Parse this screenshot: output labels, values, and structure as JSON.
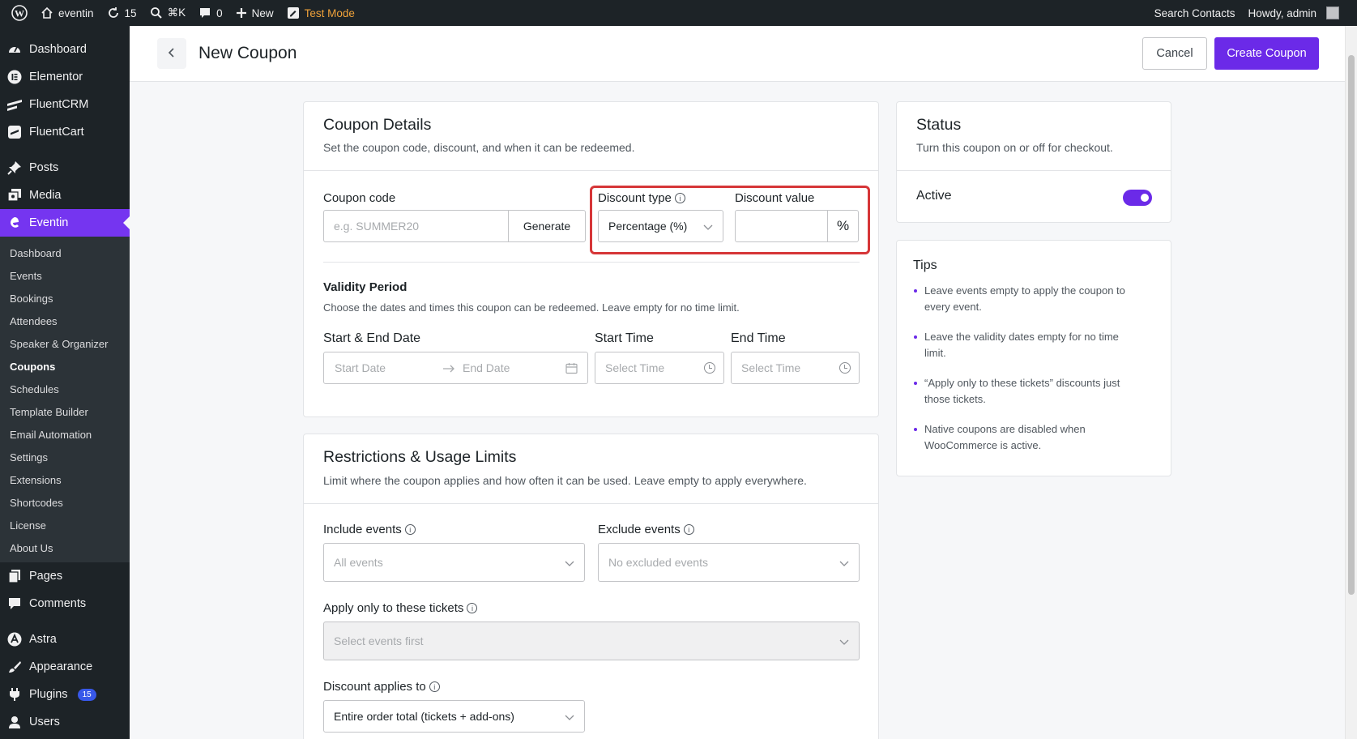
{
  "adminbar": {
    "site_name": "eventin",
    "updates_count": "15",
    "search_shortcut": "⌘K",
    "comments_count": "0",
    "new_label": "New",
    "test_mode_label": "Test Mode",
    "search_contacts": "Search Contacts",
    "howdy": "Howdy, admin"
  },
  "sidebar": {
    "top_items": [
      {
        "label": "Dashboard",
        "icon": "dashboard-icon"
      },
      {
        "label": "Elementor",
        "icon": "elementor-icon"
      },
      {
        "label": "FluentCRM",
        "icon": "fluentcrm-icon"
      },
      {
        "label": "FluentCart",
        "icon": "fluentcart-icon"
      }
    ],
    "mid_items": [
      {
        "label": "Posts",
        "icon": "pin-icon"
      },
      {
        "label": "Media",
        "icon": "media-icon"
      }
    ],
    "active_item": {
      "label": "Eventin",
      "icon": "eventin-icon"
    },
    "submenu": [
      "Dashboard",
      "Events",
      "Bookings",
      "Attendees",
      "Speaker & Organizer",
      "Coupons",
      "Schedules",
      "Template Builder",
      "Email Automation",
      "Settings",
      "Extensions",
      "Shortcodes",
      "License",
      "About Us"
    ],
    "current_sub": "Coupons",
    "after_items": [
      {
        "label": "Pages",
        "icon": "pages-icon"
      },
      {
        "label": "Comments",
        "icon": "comments-icon"
      }
    ],
    "bottom_items": [
      {
        "label": "Astra",
        "icon": "astra-icon"
      },
      {
        "label": "Appearance",
        "icon": "appearance-icon"
      },
      {
        "label": "Plugins",
        "icon": "plugins-icon",
        "badge": "15"
      },
      {
        "label": "Users",
        "icon": "users-icon"
      }
    ]
  },
  "header": {
    "title": "New Coupon",
    "cancel_label": "Cancel",
    "create_label": "Create Coupon"
  },
  "coupon_details": {
    "title": "Coupon Details",
    "description": "Set the coupon code, discount, and when it can be redeemed.",
    "code_label": "Coupon code",
    "code_placeholder": "e.g. SUMMER20",
    "generate_label": "Generate",
    "discount_type_label": "Discount type",
    "discount_type_value": "Percentage (%)",
    "discount_value_label": "Discount value",
    "discount_value": "",
    "discount_unit": "%",
    "validity_title": "Validity Period",
    "validity_desc": "Choose the dates and times this coupon can be redeemed. Leave empty for no time limit.",
    "date_label": "Start & End Date",
    "start_date_placeholder": "Start Date",
    "end_date_placeholder": "End Date",
    "start_time_label": "Start Time",
    "end_time_label": "End Time",
    "start_time_placeholder": "Select Time",
    "end_time_placeholder": "Select Time"
  },
  "restrictions": {
    "title": "Restrictions & Usage Limits",
    "description": "Limit where the coupon applies and how often it can be used. Leave empty to apply everywhere.",
    "include_label": "Include events",
    "include_placeholder": "All events",
    "exclude_label": "Exclude events",
    "exclude_placeholder": "No excluded events",
    "tickets_label": "Apply only to these tickets",
    "tickets_placeholder": "Select events first",
    "applies_label": "Discount applies to",
    "applies_value": "Entire order total (tickets + add-ons)"
  },
  "status": {
    "title": "Status",
    "description": "Turn this coupon on or off for checkout.",
    "active_label": "Active",
    "active": true
  },
  "tips": {
    "title": "Tips",
    "items": [
      "Leave events empty to apply the coupon to every event.",
      "Leave the validity dates empty for no time limit.",
      "“Apply only to these tickets” discounts just those tickets.",
      "Native coupons are disabled when WooCommerce is active."
    ]
  },
  "colors": {
    "accent": "#6b2ae8",
    "admin_bar": "#1d2327",
    "highlight_border": "#d63638"
  }
}
